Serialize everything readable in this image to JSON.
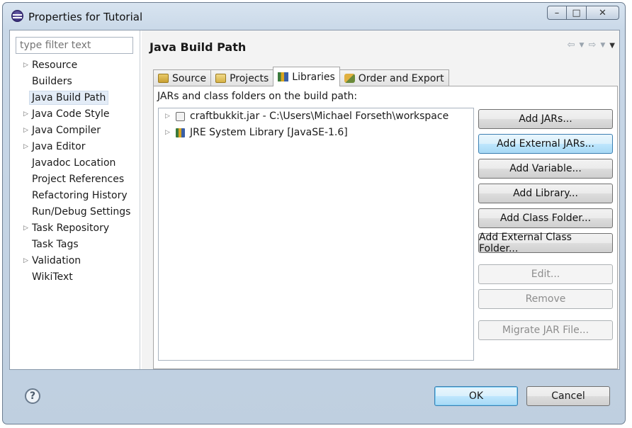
{
  "window": {
    "title": "Properties for Tutorial",
    "controls": {
      "minimize": "–",
      "maximize": "□",
      "close": "✕"
    }
  },
  "sidebar": {
    "filter_placeholder": "type filter text",
    "items": [
      {
        "label": "Resource",
        "expandable": true
      },
      {
        "label": "Builders",
        "expandable": false
      },
      {
        "label": "Java Build Path",
        "expandable": false,
        "selected": true
      },
      {
        "label": "Java Code Style",
        "expandable": true
      },
      {
        "label": "Java Compiler",
        "expandable": true
      },
      {
        "label": "Java Editor",
        "expandable": true
      },
      {
        "label": "Javadoc Location",
        "expandable": false
      },
      {
        "label": "Project References",
        "expandable": false
      },
      {
        "label": "Refactoring History",
        "expandable": false
      },
      {
        "label": "Run/Debug Settings",
        "expandable": false
      },
      {
        "label": "Task Repository",
        "expandable": true
      },
      {
        "label": "Task Tags",
        "expandable": false
      },
      {
        "label": "Validation",
        "expandable": true
      },
      {
        "label": "WikiText",
        "expandable": false
      }
    ]
  },
  "main": {
    "title": "Java Build Path",
    "tabs": [
      {
        "label": "Source",
        "icon": "source-folder-icon",
        "active": false
      },
      {
        "label": "Projects",
        "icon": "projects-icon",
        "active": false
      },
      {
        "label": "Libraries",
        "icon": "libraries-icon",
        "active": true
      },
      {
        "label": "Order and Export",
        "icon": "order-export-icon",
        "active": false
      }
    ],
    "libraries_label": "JARs and class folders on the build path:",
    "libraries": [
      {
        "label": "craftbukkit.jar - C:\\Users\\Michael Forseth\\workspace",
        "icon": "jar-icon"
      },
      {
        "label": "JRE System Library [JavaSE-1.6]",
        "icon": "library-icon"
      }
    ],
    "buttons": [
      {
        "label": "Add JARs...",
        "state": "normal"
      },
      {
        "label": "Add External JARs...",
        "state": "hover"
      },
      {
        "label": "Add Variable...",
        "state": "normal"
      },
      {
        "label": "Add Library...",
        "state": "normal"
      },
      {
        "label": "Add Class Folder...",
        "state": "normal"
      },
      {
        "label": "Add External Class Folder...",
        "state": "normal"
      },
      {
        "label": "Edit...",
        "state": "disabled"
      },
      {
        "label": "Remove",
        "state": "disabled"
      },
      {
        "label": "Migrate JAR File...",
        "state": "disabled"
      }
    ]
  },
  "footer": {
    "help": "?",
    "ok_label": "OK",
    "cancel_label": "Cancel"
  }
}
